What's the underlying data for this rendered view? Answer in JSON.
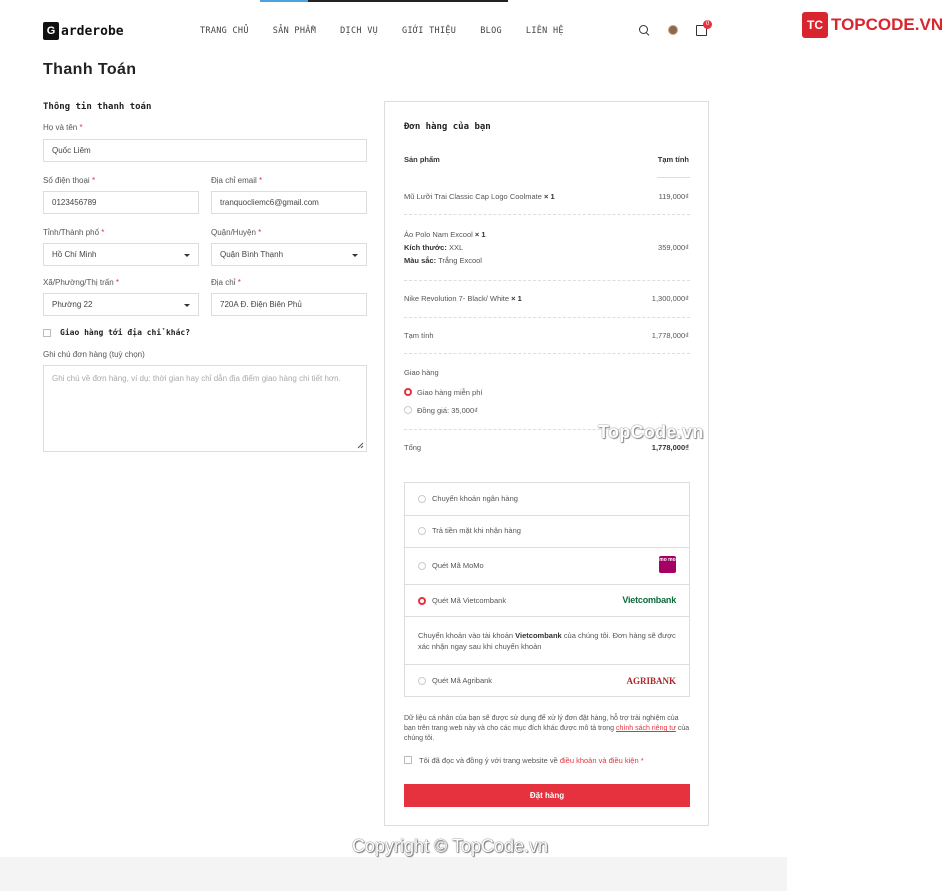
{
  "header": {
    "logo_letter": "G",
    "logo_text": "arderobe",
    "nav": [
      "TRANG CHỦ",
      "SẢN PHẨM",
      "DỊCH VỤ",
      "GIỚI THIỆU",
      "BLOG",
      "LIÊN HỆ"
    ],
    "cart_count": "0"
  },
  "brand_watermark": {
    "logo": "TC",
    "text": "TOPCODE.VN"
  },
  "page_title": "Thanh Toán",
  "billing": {
    "title": "Thông tin thanh toán",
    "name_label": "Họ và tên",
    "name_value": "Quốc Liêm",
    "phone_label": "Số điện thoại",
    "phone_value": "0123456789",
    "email_label": "Địa chỉ email",
    "email_value": "tranquocliemc6@gmail.com",
    "province_label": "Tỉnh/Thành phố",
    "province_value": "Hồ Chí Minh",
    "district_label": "Quận/Huyện",
    "district_value": "Quận Bình Thạnh",
    "ward_label": "Xã/Phường/Thị trấn",
    "ward_value": "Phường 22",
    "address_label": "Địa chỉ",
    "address_value": "720A Đ. Điện Biên Phủ",
    "ship_other_label": "Giao hàng tới địa chỉ khác?",
    "notes_label": "Ghi chú đơn hàng (tuỳ chọn)",
    "notes_placeholder": "Ghi chú về đơn hàng, ví dụ: thời gian hay chỉ dẫn địa điểm giao hàng chi tiết hơn.",
    "required_mark": "*"
  },
  "order": {
    "title": "Đơn hàng của bạn",
    "col_product": "Sản phẩm",
    "col_subtotal": "Tạm tính",
    "items": [
      {
        "name": "Mũ Lưỡi Trai Classic Cap Logo Coolmate",
        "qty": "× 1",
        "price": "119,000₫"
      },
      {
        "name": "Áo Polo Nam Excool",
        "qty": "× 1",
        "size_label": "Kích thước:",
        "size": "XXL",
        "color_label": "Màu sắc:",
        "color": "Trắng Excool",
        "price": "359,000₫"
      },
      {
        "name": "Nike Revolution 7- Black/ White",
        "qty": "× 1",
        "price": "1,300,000₫"
      }
    ],
    "subtotal_label": "Tạm tính",
    "subtotal_value": "1,778,000₫",
    "shipping_label": "Giao hàng",
    "shipping_options": [
      "Giao hàng miễn phí",
      "Đồng giá: 35,000₫"
    ],
    "total_label": "Tổng",
    "total_value": "1,778,000₫"
  },
  "payment": {
    "options": [
      "Chuyển khoản ngân hàng",
      "Trả tiền mặt khi nhận hàng",
      "Quét Mã MoMo",
      "Quét Mã Vietcombank",
      "Quét Mã Agribank"
    ],
    "selected": "Quét Mã Vietcombank",
    "momo_logo": "mo mo",
    "vcb_logo": "Vietcombank",
    "agri_logo": "AGRIBANK",
    "vcb_desc_prefix": "Chuyển khoản vào tài khoản ",
    "vcb_desc_bold": "Vietcombank",
    "vcb_desc_suffix": " của chúng tôi. Đơn hàng sẽ được xác nhận ngay sau khi chuyển khoản"
  },
  "privacy": {
    "text_before": "Dữ liệu cá nhân của bạn sẽ được sử dụng để xử lý đơn đặt hàng, hỗ trợ trải nghiệm của bạn trên trang web này và cho các mục đích khác được mô tả trong ",
    "link": "chính sách riêng tư",
    "text_after": " của chúng tôi."
  },
  "terms": {
    "text": "Tôi đã đọc và đồng ý với trang website về ",
    "link": "điều khoản và điều kiện",
    "required": "*"
  },
  "order_button": "Đặt hàng",
  "watermark_mid": "TopCode.vn",
  "copyright": "Copyright © TopCode.vn"
}
